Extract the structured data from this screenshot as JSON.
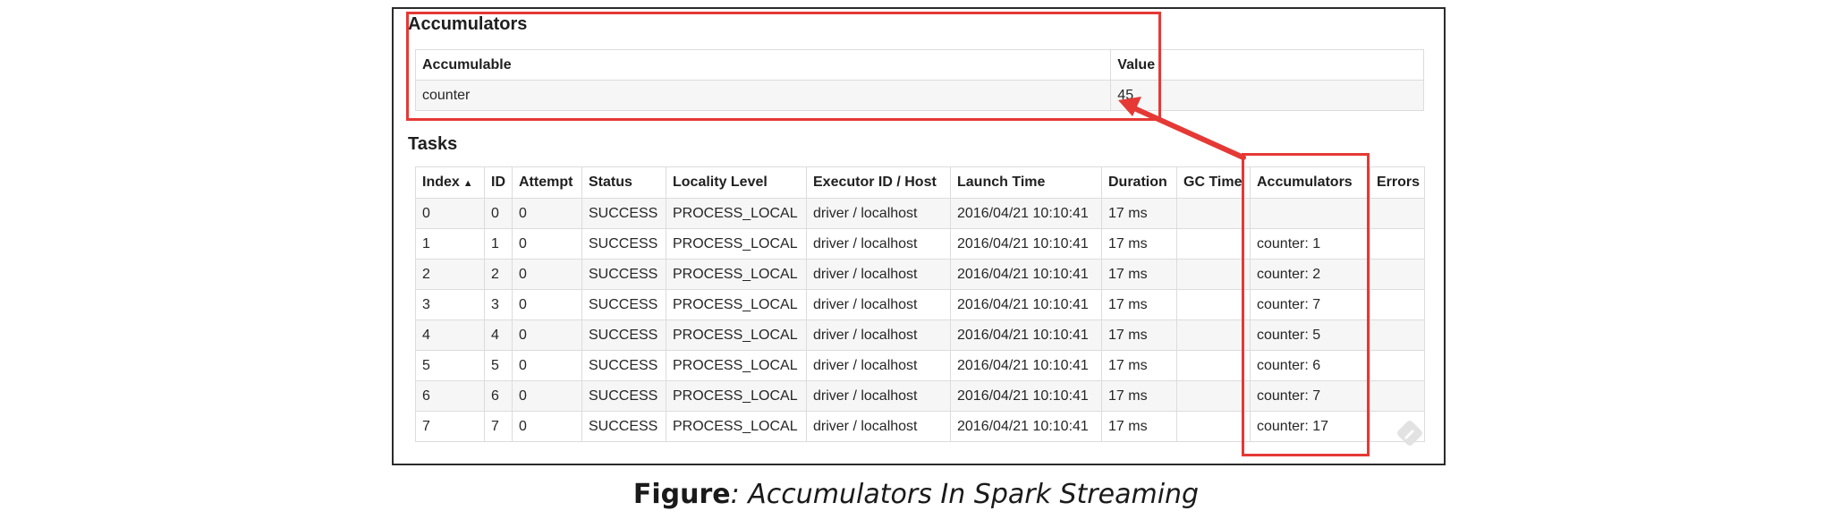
{
  "accumulators": {
    "title": "Accumulators",
    "headers": [
      "Accumulable",
      "Value"
    ],
    "rows": [
      {
        "name": "counter",
        "value": "45"
      }
    ]
  },
  "tasks": {
    "title": "Tasks",
    "sort_indicator": "▲",
    "headers": [
      "Index",
      "ID",
      "Attempt",
      "Status",
      "Locality Level",
      "Executor ID / Host",
      "Launch Time",
      "Duration",
      "GC Time",
      "Accumulators",
      "Errors"
    ],
    "rows": [
      {
        "index": "0",
        "id": "0",
        "attempt": "0",
        "status": "SUCCESS",
        "locality": "PROCESS_LOCAL",
        "executor": "driver / localhost",
        "launch": "2016/04/21 10:10:41",
        "duration": "17 ms",
        "gc": "",
        "acc": "",
        "errors": ""
      },
      {
        "index": "1",
        "id": "1",
        "attempt": "0",
        "status": "SUCCESS",
        "locality": "PROCESS_LOCAL",
        "executor": "driver / localhost",
        "launch": "2016/04/21 10:10:41",
        "duration": "17 ms",
        "gc": "",
        "acc": "counter: 1",
        "errors": ""
      },
      {
        "index": "2",
        "id": "2",
        "attempt": "0",
        "status": "SUCCESS",
        "locality": "PROCESS_LOCAL",
        "executor": "driver / localhost",
        "launch": "2016/04/21 10:10:41",
        "duration": "17 ms",
        "gc": "",
        "acc": "counter: 2",
        "errors": ""
      },
      {
        "index": "3",
        "id": "3",
        "attempt": "0",
        "status": "SUCCESS",
        "locality": "PROCESS_LOCAL",
        "executor": "driver / localhost",
        "launch": "2016/04/21 10:10:41",
        "duration": "17 ms",
        "gc": "",
        "acc": "counter: 7",
        "errors": ""
      },
      {
        "index": "4",
        "id": "4",
        "attempt": "0",
        "status": "SUCCESS",
        "locality": "PROCESS_LOCAL",
        "executor": "driver / localhost",
        "launch": "2016/04/21 10:10:41",
        "duration": "17 ms",
        "gc": "",
        "acc": "counter: 5",
        "errors": ""
      },
      {
        "index": "5",
        "id": "5",
        "attempt": "0",
        "status": "SUCCESS",
        "locality": "PROCESS_LOCAL",
        "executor": "driver / localhost",
        "launch": "2016/04/21 10:10:41",
        "duration": "17 ms",
        "gc": "",
        "acc": "counter: 6",
        "errors": ""
      },
      {
        "index": "6",
        "id": "6",
        "attempt": "0",
        "status": "SUCCESS",
        "locality": "PROCESS_LOCAL",
        "executor": "driver / localhost",
        "launch": "2016/04/21 10:10:41",
        "duration": "17 ms",
        "gc": "",
        "acc": "counter: 7",
        "errors": ""
      },
      {
        "index": "7",
        "id": "7",
        "attempt": "0",
        "status": "SUCCESS",
        "locality": "PROCESS_LOCAL",
        "executor": "driver / localhost",
        "launch": "2016/04/21 10:10:41",
        "duration": "17 ms",
        "gc": "",
        "acc": "counter: 17",
        "errors": ""
      }
    ]
  },
  "caption": {
    "bold": "Figure",
    "italic": ": Accumulators In Spark Streaming"
  },
  "colors": {
    "highlight": "#e53935",
    "row_alt": "#f6f6f6",
    "border": "#dcdcdc"
  },
  "icons": {
    "watermark": "pencil-badge-icon",
    "sort": "sort-ascending-icon"
  }
}
